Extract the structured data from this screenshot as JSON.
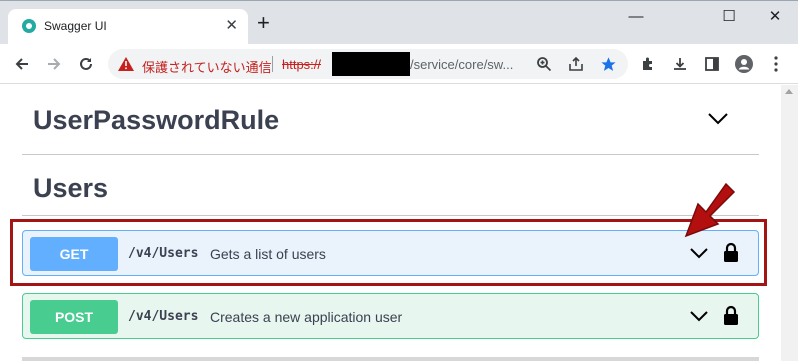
{
  "browser": {
    "tab_title": "Swagger UI",
    "new_tab": "+",
    "window_controls": {
      "minimize": "—",
      "maximize": "☐",
      "close": "✕"
    },
    "address_bar": {
      "security_warning": "保護されていない通信",
      "url_scheme": "https://",
      "url_redacted": true,
      "url_path": "/service/core/sw..."
    }
  },
  "page": {
    "sections": [
      {
        "title": "UserPasswordRule"
      },
      {
        "title": "Users"
      }
    ],
    "operations": [
      {
        "method": "GET",
        "path": "/v4/Users",
        "description": "Gets a list of users",
        "color": "#61affe",
        "highlighted": true
      },
      {
        "method": "POST",
        "path": "/v4/Users",
        "description": "Creates a new application user",
        "color": "#49cc90",
        "highlighted": false
      }
    ]
  },
  "annotations": {
    "highlight_color": "#a31515",
    "arrow_color": "#b30f0f"
  }
}
